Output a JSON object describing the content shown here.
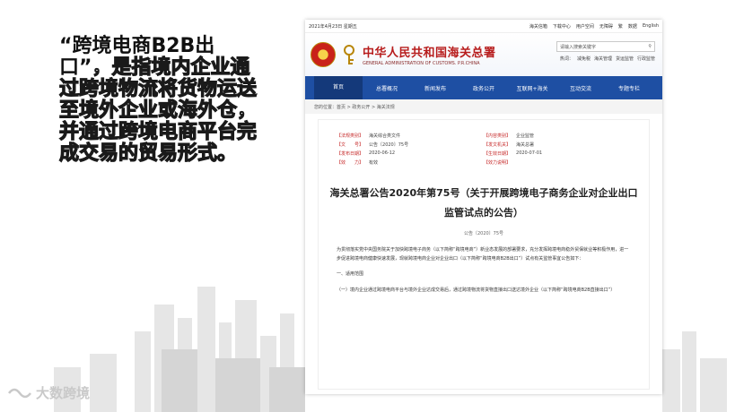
{
  "slide": {
    "heading_bold": "“跨境电商B2B出口”",
    "body": "，是指境内企业通过跨境物流将货物运送至境外企业或海外仓，并通过跨境电商平台完成交易的贸易形式。"
  },
  "logo": {
    "text": "大数跨境"
  },
  "site": {
    "date": "2021年4月23日 星期五",
    "top_links": [
      "海关信箱",
      "下载中心",
      "用户空间",
      "无障碍",
      "繁",
      "数据",
      "English"
    ],
    "title_cn": "中华人民共和国海关总署",
    "title_en": "GENERAL ADMINISTRATION OF CUSTOMS. P.R.CHINA",
    "search_placeholder": "请输入搜索关键字",
    "hot_label": "热词：",
    "hot_words": [
      "减免税",
      "海关管理",
      "货运监管",
      "行政监管"
    ],
    "nav": [
      "首页",
      "总署概况",
      "新闻发布",
      "政务公开",
      "互联网+海关",
      "互动交流",
      "专题专栏"
    ],
    "breadcrumb": "您的位置：首页 > 政务公开 > 海关法规",
    "meta": [
      {
        "k": "【法规类别】",
        "v": "海关综合类文件"
      },
      {
        "k": "【发文机关】",
        "v": "海关总署"
      },
      {
        "k": "【文　　号】",
        "v": "公告〔2020〕75号"
      },
      {
        "k": "【内容类别】",
        "v": "企业监管"
      },
      {
        "k": "【发布日期】",
        "v": "2020-06-12"
      },
      {
        "k": "【生效日期】",
        "v": "2020-07-01"
      },
      {
        "k": "【效　　力】",
        "v": "有效"
      },
      {
        "k": "【效力说明】",
        "v": ""
      }
    ],
    "doc_title": "海关总署公告2020年第75号（关于开展跨境电子商务企业对企业出口监管试点的公告）",
    "doc_number": "公告〔2020〕75号",
    "paragraph": "为贯彻落实党中央国务院关于加快跨境电子商务（以下简称“跨境电商”）新业态发展的部署要求，充分发挥跨境电商稳外贸保就业等积极作用，进一步促进跨境电商健康快速发展，现就跨境电商企业对企业出口（以下简称“跨境电商B2B出口”）试点有关监管事宜公告如下：",
    "section1": "一、适用范围",
    "section1_text": "（一）境内企业通过跨境电商平台与境外企业达成交易后，通过跨境物流将货物直接出口送达境外企业（以下简称“跨境电商B2B直接出口”）"
  }
}
